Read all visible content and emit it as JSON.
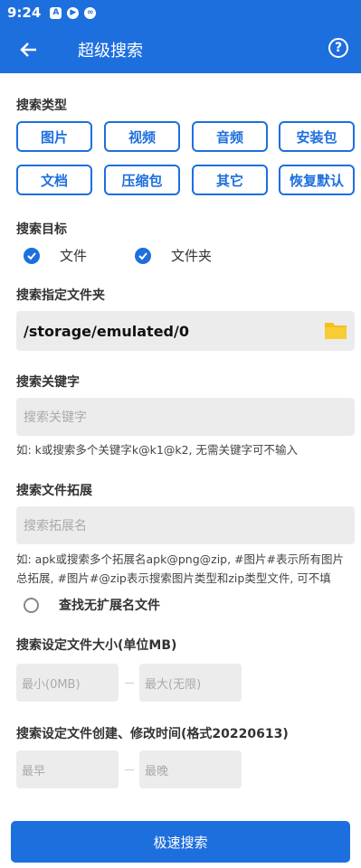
{
  "status": {
    "time": "9:24",
    "icons": [
      "A",
      "▶",
      "∞"
    ]
  },
  "appbar": {
    "title": "超级搜索",
    "help": "?"
  },
  "search_type": {
    "label": "搜索类型",
    "buttons": [
      "图片",
      "视频",
      "音频",
      "安装包",
      "文档",
      "压缩包",
      "其它",
      "恢复默认"
    ]
  },
  "search_target": {
    "label": "搜索目标",
    "options": [
      "文件",
      "文件夹"
    ]
  },
  "folder": {
    "label": "搜索指定文件夹",
    "path": "/storage/emulated/0"
  },
  "keyword": {
    "label": "搜索关键字",
    "placeholder": "搜索关键字",
    "hint": "如: k或搜索多个关键字k@k1@k2, 无需关键字可不输入"
  },
  "extension": {
    "label": "搜索文件拓展",
    "placeholder": "搜索拓展名",
    "hint1": "如: apk或搜索多个拓展名apk@png@zip, #图片#表示所有图片",
    "hint2": "总拓展, #图片#@zip表示搜索图片类型和zip类型文件, 可不填",
    "no_ext": "查找无扩展名文件"
  },
  "size": {
    "label": "搜索设定文件大小(单位MB)",
    "min_placeholder": "最小(0MB)",
    "max_placeholder": "最大(无限)"
  },
  "time": {
    "label": "搜索设定文件创建、修改时间(格式20220613)",
    "from_placeholder": "最早",
    "to_placeholder": "最晚"
  },
  "action": {
    "search": "极速搜索"
  },
  "colors": {
    "primary": "#1e6fde",
    "field_bg": "#ececec",
    "folder_icon": "#f5c01a"
  }
}
